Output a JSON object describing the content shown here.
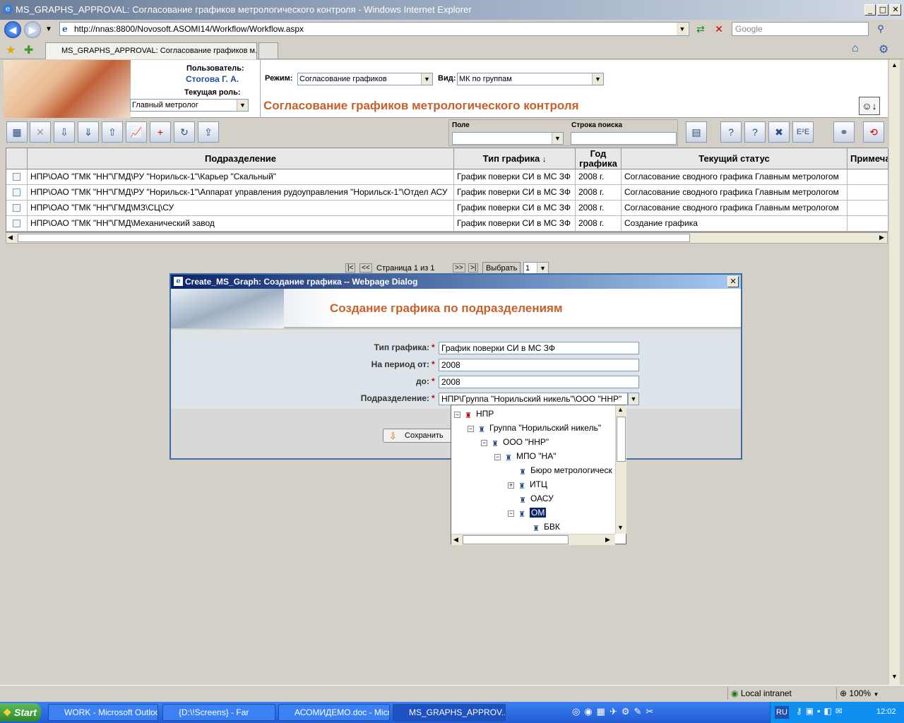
{
  "window": {
    "title": "MS_GRAPHS_APPROVAL: Согласование графиков метрологического контроля - Windows Internet Explorer",
    "address": "http://nnas:8800/Novosoft.ASOMI14/Workflow/Workflow.aspx",
    "search_placeholder": "Google",
    "tab_title": "MS_GRAPHS_APPROVAL: Согласование графиков м..."
  },
  "header": {
    "user_label": "Пользователь:",
    "user_name": "Стогова Г. А.",
    "role_label": "Текущая роль:",
    "role_value": "Главный метролог",
    "mode_label": "Режим:",
    "mode_value": "Согласование графиков",
    "view_label": "Вид:",
    "view_value": "МК по группам",
    "page_title": "Согласование графиков метрологического контроля"
  },
  "search": {
    "field_label": "Поле",
    "field_value": "",
    "query_label": "Строка поиска",
    "query_value": ""
  },
  "grid": {
    "columns": [
      "Подразделение",
      "Тип графика",
      "Год графика",
      "Текущий статус",
      "Примеча"
    ],
    "year_line1": "Год",
    "year_line2": "графика",
    "sort_icon": "↓",
    "rows": [
      {
        "dept": "НПР\\ОАО \"ГМК \"НН\"\\ГМД\\РУ \"Норильск-1\"\\Карьер \"Скальный\"",
        "type": "График поверки СИ в МС ЗФ",
        "year": "2008 г.",
        "status": "Согласование сводного графика Главным метрологом"
      },
      {
        "dept": "НПР\\ОАО \"ГМК \"НН\"\\ГМД\\РУ \"Норильск-1\"\\Аппарат управления рудоуправления \"Норильск-1\"\\Отдел АСУ",
        "type": "График поверки СИ в МС ЗФ",
        "year": "2008 г.",
        "status": "Согласование сводного графика Главным метрологом"
      },
      {
        "dept": "НПР\\ОАО \"ГМК \"НН\"\\ГМД\\МЗ\\СЦ\\СУ",
        "type": "График поверки СИ в МС ЗФ",
        "year": "2008 г.",
        "status": "Согласование сводного графика Главным метрологом"
      },
      {
        "dept": "НПР\\ОАО \"ГМК \"НН\"\\ГМД\\Механический завод",
        "type": "График поверки СИ в МС ЗФ",
        "year": "2008 г.",
        "status": "Создание графика"
      }
    ]
  },
  "pager": {
    "page_text": "Страница  1  из  1",
    "choose_label": "Выбрать",
    "page_value": "1"
  },
  "dialog": {
    "title": "Create_MS_Graph: Создание графика -- Webpage Dialog",
    "heading": "Создание графика по подразделениям",
    "fields": [
      {
        "label": "Тип графика:",
        "value": "График поверки СИ в МС ЗФ"
      },
      {
        "label": "На период от:",
        "value": "2008"
      },
      {
        "label": "до:",
        "value": "2008"
      },
      {
        "label": "Подразделение:",
        "value": "НПР\\Группа \"Норильский никель\"\\ООО \"ННР\""
      }
    ],
    "save_label": "Сохранить"
  },
  "tree": {
    "nodes": [
      {
        "label": "НПР"
      },
      {
        "label": "Группа \"Норильский никель\""
      },
      {
        "label": "ООО \"ННР\""
      },
      {
        "label": "МПО \"НА\""
      },
      {
        "label": "Бюро метрологическ"
      },
      {
        "label": "ИТЦ"
      },
      {
        "label": "ОАСУ"
      },
      {
        "label": "ОМ"
      },
      {
        "label": "БВК"
      }
    ]
  },
  "status": {
    "zone": "Local intranet",
    "zoom": "100%"
  },
  "taskbar": {
    "start": "Start",
    "tasks": [
      "WORK - Microsoft Outlook",
      "{D:\\!Screens} - Far",
      "АСОМИДЕМО.doc - Micr...",
      "MS_GRAPHS_APPROV..."
    ],
    "lang": "RU",
    "clock": "12:02"
  }
}
